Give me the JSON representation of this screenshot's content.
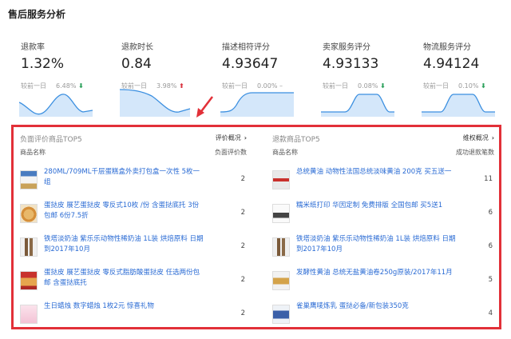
{
  "page_title": "售后服务分析",
  "metrics": [
    {
      "label": "退款率",
      "value": "1.32%",
      "cmp_label": "较前一日",
      "cmp_value": "6.48%",
      "trend": "down"
    },
    {
      "label": "退款时长",
      "value": "0.84",
      "cmp_label": "较前一日",
      "cmp_value": "3.98%",
      "trend": "up"
    },
    {
      "label": "描述相符评分",
      "value": "4.93647",
      "cmp_label": "较前一日",
      "cmp_value": "0.00%",
      "trend": "flat"
    },
    {
      "label": "卖家服务评分",
      "value": "4.93133",
      "cmp_label": "较前一日",
      "cmp_value": "0.08%",
      "trend": "down"
    },
    {
      "label": "物流服务评分",
      "value": "4.94124",
      "cmp_label": "较前一日",
      "cmp_value": "0.10%",
      "trend": "down"
    }
  ],
  "icons": {
    "down": "arrow-down-icon",
    "up": "arrow-up-icon",
    "flat": "dash-icon",
    "link": "chevron-right-icon"
  },
  "trend_glyphs": {
    "down": "⬇",
    "up": "⬆",
    "flat": "–"
  },
  "colors": {
    "sparkline_stroke": "#3b8fe0",
    "sparkline_fill": "#d4e7fa",
    "highlight_border": "#e23038",
    "pointer_arrow": "#e23038",
    "link_text": "#2a6bd4"
  },
  "left_panel": {
    "title": "负面评价商品TOP5",
    "link": "评价概况",
    "header_name": "商品名称",
    "header_count": "负面评价数",
    "rows": [
      {
        "name": "280ML/709ML千层蛋糕盒外卖打包盒一次性 5枚一组",
        "count": "2"
      },
      {
        "name": "蛋挞皮 展艺蛋挞皮 零反式10枚 /份 含蛋挞底托 3份包邮 6份7.5折",
        "count": "2"
      },
      {
        "name": "铁塔淡奶油 紫乐乐动物性稀奶油 1L装 烘焙原料 日期到2017年10月",
        "count": "2"
      },
      {
        "name": "蛋挞皮 展艺蛋挞皮 零反式脂肪酸蛋挞皮 任选两份包邮 含蛋挞底托",
        "count": "2"
      },
      {
        "name": "生日蜡烛 数字蜡烛 1枚2元 惊喜礼物",
        "count": "2"
      }
    ]
  },
  "right_panel": {
    "title": "退款商品TOP5",
    "link": "维权概况",
    "header_name": "商品名称",
    "header_count": "成功退款笔数",
    "rows": [
      {
        "name": "总统黄油 动物性法国总统淡味黄油 200克 买五送一",
        "count": "11"
      },
      {
        "name": "糯米纸打印 华因定制 免费排版 全国包邮 买5送1",
        "count": "6"
      },
      {
        "name": "铁塔淡奶油 紫乐乐动物性稀奶油 1L装 烘焙原料 日期到2017年10月",
        "count": "6"
      },
      {
        "name": "发酵性黄油 总统无盐黄油卷250g原装/2017年11月",
        "count": "5"
      },
      {
        "name": "雀巢鹰唛炼乳 蛋挞必备/新包装350克",
        "count": "4"
      }
    ]
  }
}
